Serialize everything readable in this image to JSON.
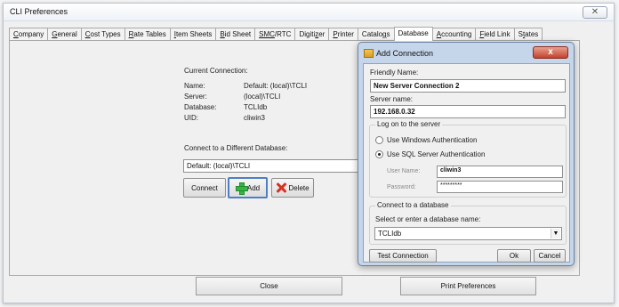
{
  "window": {
    "title": "CLI Preferences"
  },
  "tabs": [
    {
      "label": "Company",
      "u": "C",
      "rest": "ompany"
    },
    {
      "label": "General",
      "u": "G",
      "rest": "eneral"
    },
    {
      "label": "Cost Types",
      "u": "C",
      "rest": "ost Types"
    },
    {
      "label": "Rate Tables",
      "u": "R",
      "rest": "ate Tables"
    },
    {
      "label": "Item Sheets",
      "u": "I",
      "rest": "tem Sheets"
    },
    {
      "label": "Bid Sheet",
      "u": "B",
      "rest": "id Sheet"
    },
    {
      "label": "SMC/RTC",
      "u": "SMC",
      "rest": "/RTC"
    },
    {
      "label": "Digitizer",
      "pre": "Digiti",
      "u": "z",
      "rest": "er"
    },
    {
      "label": "Printer",
      "u": "P",
      "rest": "rinter"
    },
    {
      "label": "Catalogs",
      "pre": "Catalo",
      "u": "g",
      "rest": "s"
    },
    {
      "label": "Database",
      "active": true
    },
    {
      "label": "Accounting",
      "u": "A",
      "rest": "ccounting"
    },
    {
      "label": "Field Link",
      "u": "F",
      "rest": "ield Link"
    },
    {
      "label": "States",
      "pre": "S",
      "u": "t",
      "rest": "ates"
    }
  ],
  "current_connection": {
    "heading": "Current Connection:",
    "name_label": "Name:",
    "name_value": "Default: (local)\\TCLI",
    "server_label": "Server:",
    "server_value": "(local)\\TCLI",
    "database_label": "Database:",
    "database_value": "TCLIdb",
    "uid_label": "UID:",
    "uid_value": "cliwin3"
  },
  "connect_different": {
    "label": "Connect to a Different Database:",
    "selected": "Default: (local)\\TCLI",
    "connect_label": "Connect",
    "add_label": "Add",
    "delete_label": "Delete"
  },
  "bottom": {
    "close_label": "Close",
    "print_label": "Print Preferences"
  },
  "dialog": {
    "title": "Add Connection",
    "close_glyph": "x",
    "friendly_name_label": "Friendly Name:",
    "friendly_name_value": "New Server Connection 2",
    "server_name_label": "Server name:",
    "server_name_value": "192.168.0.32",
    "logon_group": "Log on to the server",
    "windows_auth_label": "Use Windows Authentication",
    "sql_auth_label": "Use SQL Server Authentication",
    "user_name_label": "User Name:",
    "user_name_value": "cliwin3",
    "password_label": "Password:",
    "password_value": "*********",
    "db_group": "Connect to a database",
    "db_select_label": "Select or enter a database name:",
    "db_select_value": "TCLIdb",
    "test_label": "Test Connection",
    "ok_label": "Ok",
    "cancel_label": "Cancel"
  }
}
